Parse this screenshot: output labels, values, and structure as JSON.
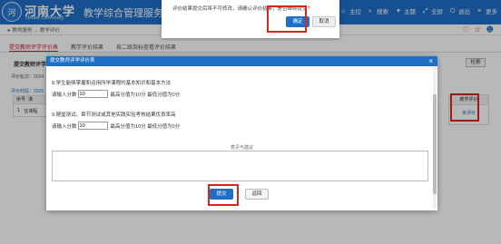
{
  "header": {
    "logo_char": "河",
    "university_cn": "河南大学",
    "university_en": "Henan University",
    "system_title": "教学综合管理服务",
    "nav": [
      {
        "icon": "⌂",
        "label": "主控"
      },
      {
        "icon": "⌕",
        "label": "搜索"
      },
      {
        "icon": "✦",
        "label": "主题"
      },
      {
        "icon": "⤢",
        "label": "全屏"
      },
      {
        "icon": "⏻",
        "label": "退出"
      },
      {
        "icon": "≡",
        "label": "更多"
      }
    ]
  },
  "breadcrumb": {
    "text": "教师服务 → 教学评价"
  },
  "top_icons": {
    "heart": "♡",
    "star": "☆",
    "user": "☻"
  },
  "tabs": [
    {
      "label": "提交教师评学评价表",
      "active": true
    },
    {
      "label": "教学评价结果",
      "active": false
    },
    {
      "label": "按二级指标查看评价结果",
      "active": false
    }
  ],
  "panel": {
    "title": "提交教师评学评价表",
    "search_label": "检索",
    "term_label": "评价轮次：2024",
    "info_text": "评价时段：2025",
    "table_headers": [
      "序号",
      "课"
    ],
    "table_row": [
      "1",
      "住课程"
    ],
    "right_header": "教学评价",
    "right_cell": "未评价"
  },
  "confirm": {
    "message": "评价结果提交后将不可修改，请确认评价结果，是否继续提交?",
    "ok_label": "确定",
    "cancel_label": "取消"
  },
  "modal": {
    "title": "提交教师评学评价表",
    "close_icon": "×",
    "q8": "8.学生能够掌握和运用所学课程的基本知识和基本方法",
    "q8_prefix": "请输入分数",
    "q8_value": "10",
    "q8_hint": "最高分值为10分 最低分值为0分",
    "q9": "9.随堂测试、章节测试或其他实践实验考核结果优良率高",
    "q9_prefix": "请输入分数",
    "q9_value": "10",
    "q9_hint": "最高分值为10分 最低分值为0分",
    "suggest_label": "意见与建议",
    "submit_label": "提交",
    "back_label": "返回"
  }
}
